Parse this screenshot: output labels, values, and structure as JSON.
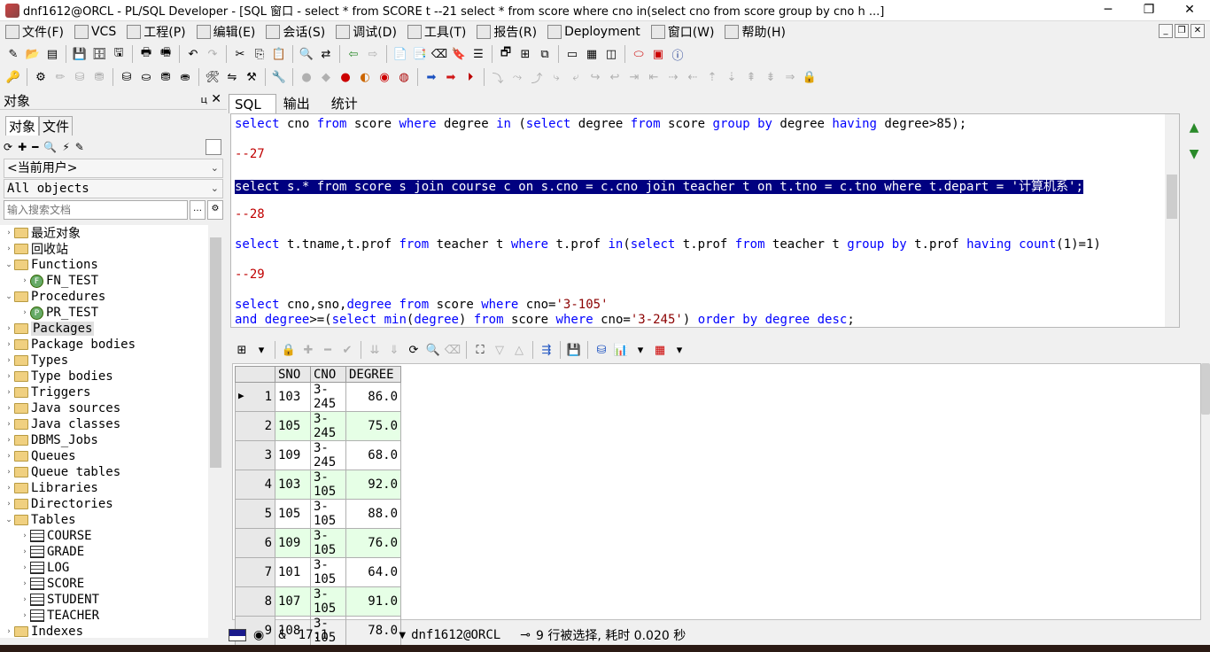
{
  "window": {
    "title": "dnf1612@ORCL - PL/SQL Developer - [SQL 窗口 - select * from SCORE t --21 select * from score where cno in(select cno from score group by cno h ...]",
    "minimize": "─",
    "maximize": "❐",
    "close": "✕"
  },
  "menu": [
    {
      "label": "文件(F)",
      "icon": "file-icon"
    },
    {
      "label": "VCS",
      "icon": "vcs-icon"
    },
    {
      "label": "工程(P)",
      "icon": "project-icon"
    },
    {
      "label": "编辑(E)",
      "icon": "edit-icon"
    },
    {
      "label": "会话(S)",
      "icon": "session-icon"
    },
    {
      "label": "调试(D)",
      "icon": "debug-icon"
    },
    {
      "label": "工具(T)",
      "icon": "tools-icon"
    },
    {
      "label": "报告(R)",
      "icon": "report-icon"
    },
    {
      "label": "Deployment",
      "icon": "deployment-icon"
    },
    {
      "label": "窗口(W)",
      "icon": "window-icon"
    },
    {
      "label": "帮助(H)",
      "icon": "help-icon"
    }
  ],
  "left_panel": {
    "title": "对象",
    "pin": "ц",
    "close": "✕",
    "tabs": [
      "对象",
      "文件"
    ],
    "user_combo": "<当前用户>",
    "filter_combo": "All objects",
    "search_placeholder": "输入搜索文档",
    "tree": [
      {
        "label": "最近对象",
        "type": "folder",
        "toggle": "›",
        "indent": 0
      },
      {
        "label": "回收站",
        "type": "folder",
        "toggle": "›",
        "indent": 0
      },
      {
        "label": "Functions",
        "type": "folder",
        "toggle": "⌄",
        "indent": 0
      },
      {
        "label": "FN_TEST",
        "type": "func",
        "toggle": "›",
        "indent": 1
      },
      {
        "label": "Procedures",
        "type": "folder",
        "toggle": "⌄",
        "indent": 0
      },
      {
        "label": "PR_TEST",
        "type": "proc",
        "toggle": "›",
        "indent": 1
      },
      {
        "label": "Packages",
        "type": "folder",
        "toggle": "›",
        "indent": 0,
        "highlight": true
      },
      {
        "label": "Package bodies",
        "type": "folder",
        "toggle": "›",
        "indent": 0
      },
      {
        "label": "Types",
        "type": "folder",
        "toggle": "›",
        "indent": 0
      },
      {
        "label": "Type bodies",
        "type": "folder",
        "toggle": "›",
        "indent": 0
      },
      {
        "label": "Triggers",
        "type": "folder",
        "toggle": "›",
        "indent": 0
      },
      {
        "label": "Java sources",
        "type": "folder",
        "toggle": "›",
        "indent": 0
      },
      {
        "label": "Java classes",
        "type": "folder",
        "toggle": "›",
        "indent": 0
      },
      {
        "label": "DBMS_Jobs",
        "type": "folder",
        "toggle": "›",
        "indent": 0
      },
      {
        "label": "Queues",
        "type": "folder",
        "toggle": "›",
        "indent": 0
      },
      {
        "label": "Queue tables",
        "type": "folder",
        "toggle": "›",
        "indent": 0
      },
      {
        "label": "Libraries",
        "type": "folder",
        "toggle": "›",
        "indent": 0
      },
      {
        "label": "Directories",
        "type": "folder",
        "toggle": "›",
        "indent": 0
      },
      {
        "label": "Tables",
        "type": "folder",
        "toggle": "⌄",
        "indent": 0
      },
      {
        "label": "COURSE",
        "type": "table",
        "toggle": "›",
        "indent": 1
      },
      {
        "label": "GRADE",
        "type": "table",
        "toggle": "›",
        "indent": 1
      },
      {
        "label": "LOG",
        "type": "table",
        "toggle": "›",
        "indent": 1
      },
      {
        "label": "SCORE",
        "type": "table",
        "toggle": "›",
        "indent": 1
      },
      {
        "label": "STUDENT",
        "type": "table",
        "toggle": "›",
        "indent": 1
      },
      {
        "label": "TEACHER",
        "type": "table",
        "toggle": "›",
        "indent": 1
      },
      {
        "label": "Indexes",
        "type": "folder",
        "toggle": "›",
        "indent": 0
      }
    ]
  },
  "editor": {
    "tabs": [
      "SQL",
      "输出",
      "统计"
    ],
    "active_tab": "SQL",
    "lines": [
      [
        [
          "k",
          "select"
        ],
        [
          "t",
          " cno "
        ],
        [
          "k",
          "from"
        ],
        [
          "t",
          " score "
        ],
        [
          "k",
          "where"
        ],
        [
          "t",
          " degree "
        ],
        [
          "k",
          "in"
        ],
        [
          "t",
          " ("
        ],
        [
          "k",
          "select"
        ],
        [
          "t",
          " degree "
        ],
        [
          "k",
          "from"
        ],
        [
          "t",
          " score "
        ],
        [
          "k",
          "group by"
        ],
        [
          "t",
          " degree "
        ],
        [
          "k",
          "having"
        ],
        [
          "t",
          " degree>85);"
        ]
      ],
      [],
      [
        [
          "c",
          "--27"
        ]
      ],
      [],
      [
        [
          "s",
          "select s.* from score s join course c on s.cno = c.cno join teacher t on t.tno = c.tno where t.depart = '计算机系';"
        ]
      ],
      [],
      [
        [
          "c",
          "--28"
        ]
      ],
      [],
      [
        [
          "k",
          "select"
        ],
        [
          "t",
          " t.tname,t.prof "
        ],
        [
          "k",
          "from"
        ],
        [
          "t",
          " teacher t "
        ],
        [
          "k",
          "where"
        ],
        [
          "t",
          " t.prof "
        ],
        [
          "k",
          "in"
        ],
        [
          "t",
          "("
        ],
        [
          "k",
          "select"
        ],
        [
          "t",
          " t.prof "
        ],
        [
          "k",
          "from"
        ],
        [
          "t",
          " teacher t "
        ],
        [
          "k",
          "group by"
        ],
        [
          "t",
          " t.prof "
        ],
        [
          "k",
          "having"
        ],
        [
          "t",
          " "
        ],
        [
          "k",
          "count"
        ],
        [
          "t",
          "(1)=1)"
        ]
      ],
      [],
      [
        [
          "c",
          "--29"
        ]
      ],
      [],
      [
        [
          "k",
          "select"
        ],
        [
          "t",
          " cno,sno,"
        ],
        [
          "k",
          "degree"
        ],
        [
          "t",
          " "
        ],
        [
          "k",
          "from"
        ],
        [
          "t",
          " score "
        ],
        [
          "k",
          "where"
        ],
        [
          "t",
          " cno="
        ],
        [
          "q",
          "'3-105'"
        ]
      ],
      [
        [
          "k",
          "and"
        ],
        [
          "t",
          " "
        ],
        [
          "k",
          "degree"
        ],
        [
          "t",
          ">=("
        ],
        [
          "k",
          "select"
        ],
        [
          "t",
          " "
        ],
        [
          "k",
          "min"
        ],
        [
          "t",
          "("
        ],
        [
          "k",
          "degree"
        ],
        [
          "t",
          ") "
        ],
        [
          "k",
          "from"
        ],
        [
          "t",
          " score "
        ],
        [
          "k",
          "where"
        ],
        [
          "t",
          " cno="
        ],
        [
          "q",
          "'3-245'"
        ],
        [
          "t",
          ") "
        ],
        [
          "k",
          "order by"
        ],
        [
          "t",
          " "
        ],
        [
          "k",
          "degree"
        ],
        [
          "t",
          " "
        ],
        [
          "k",
          "desc"
        ],
        [
          "t",
          ";"
        ]
      ]
    ]
  },
  "results": {
    "columns": [
      "SNO",
      "CNO",
      "DEGREE"
    ],
    "rows": [
      [
        "1",
        "103",
        "3-245",
        "86.0"
      ],
      [
        "2",
        "105",
        "3-245",
        "75.0"
      ],
      [
        "3",
        "109",
        "3-245",
        "68.0"
      ],
      [
        "4",
        "103",
        "3-105",
        "92.0"
      ],
      [
        "5",
        "105",
        "3-105",
        "88.0"
      ],
      [
        "6",
        "109",
        "3-105",
        "76.0"
      ],
      [
        "7",
        "101",
        "3-105",
        "64.0"
      ],
      [
        "8",
        "107",
        "3-105",
        "91.0"
      ],
      [
        "9",
        "108",
        "3-105",
        "78.0"
      ]
    ],
    "current_row_marker": "▶"
  },
  "status": {
    "amp": "&",
    "position": "17:1",
    "connection": "dnf1612@ORCL",
    "message": "9 行被选择, 耗时 0.020 秒"
  },
  "colors": {
    "keyword": "#0000ff",
    "comment": "#c00000",
    "string": "#8b0000",
    "selection_bg": "#000080",
    "alt_row": "#e6ffe6"
  }
}
